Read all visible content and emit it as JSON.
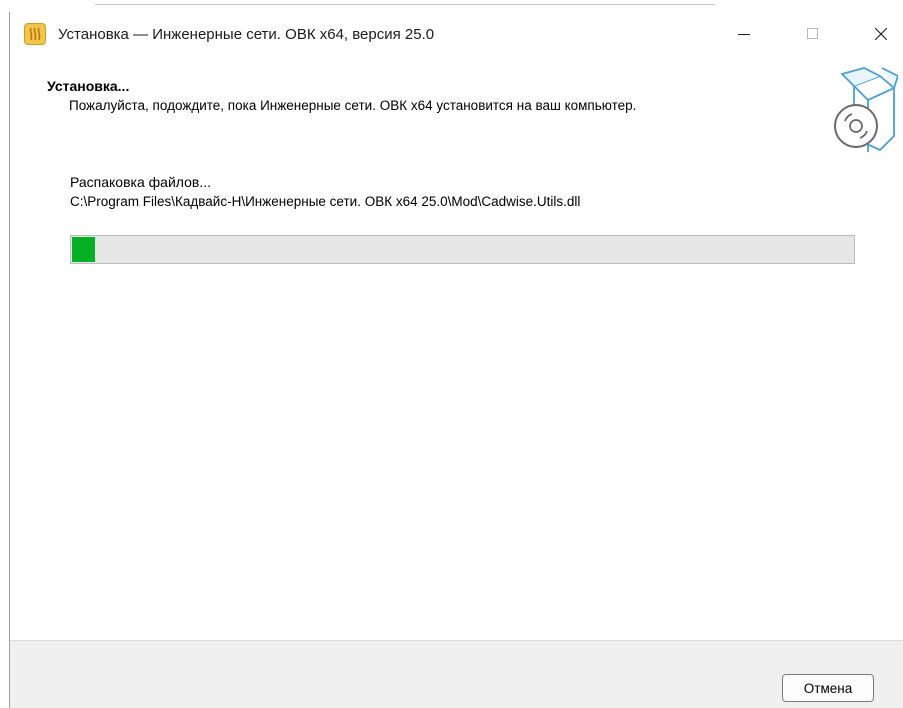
{
  "window": {
    "title": "Установка — Инженерные сети. ОВК x64, версия 25.0",
    "icon": "app-logo-icon"
  },
  "title_bar_controls": {
    "minimize": "minimize-icon",
    "maximize": "maximize-icon",
    "close": "close-icon"
  },
  "header": {
    "title": "Установка...",
    "subtitle": "Пожалуйста, подождите, пока Инженерные сети. ОВК x64 установится на ваш компьютер.",
    "icon": "box-disc-icon"
  },
  "status": {
    "text": "Распаковка файлов...",
    "file_path": "C:\\Program Files\\Кадвайс-Н\\Инженерные сети. ОВК x64 25.0\\Mod\\Cadwise.Utils.dll"
  },
  "progress": {
    "fraction": 0.03,
    "color": "#06b025"
  },
  "footer": {
    "cancel_label": "Отмена"
  }
}
